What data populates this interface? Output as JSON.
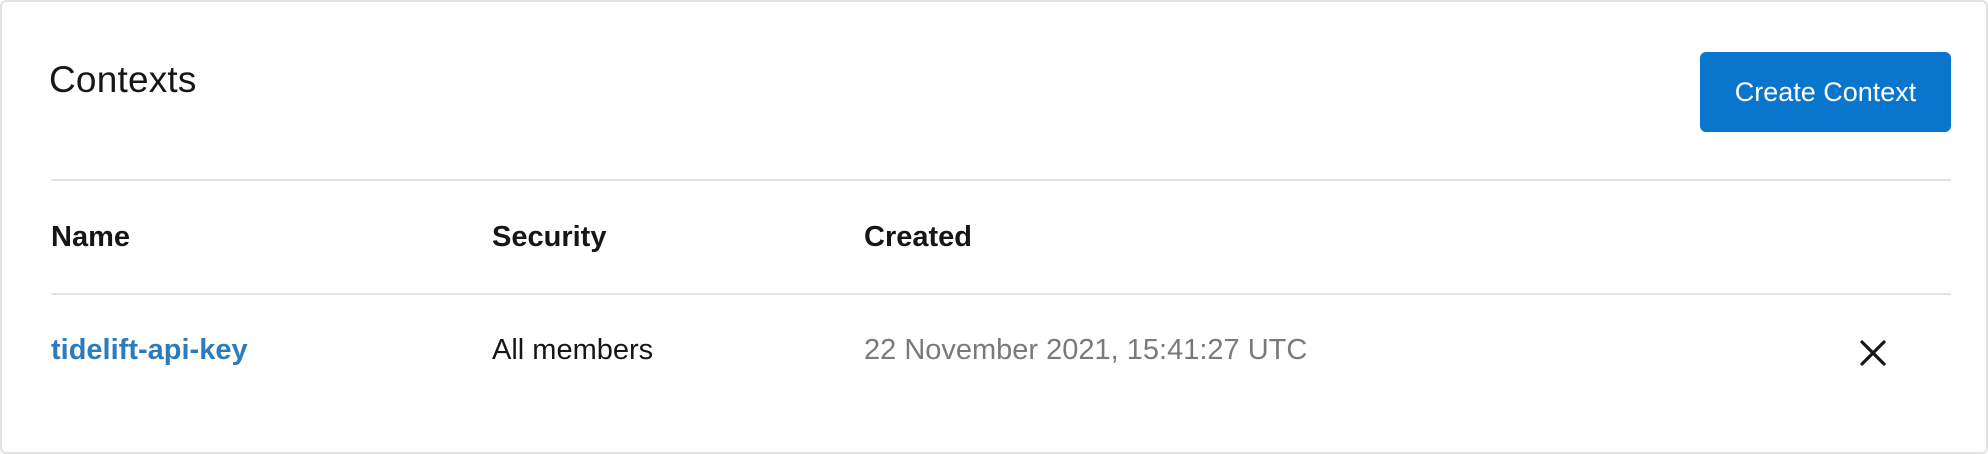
{
  "header": {
    "title": "Contexts",
    "create_button_label": "Create Context"
  },
  "table": {
    "columns": [
      "Name",
      "Security",
      "Created"
    ],
    "rows": [
      {
        "name": "tidelift-api-key",
        "security": "All members",
        "created": "22 November 2021, 15:41:27 UTC",
        "delete_icon": "close-icon"
      }
    ]
  },
  "colors": {
    "primary_button": "#0a75cc",
    "link": "#2b7bbf",
    "muted_text": "#7a7a7a",
    "divider": "#e2e2e2"
  }
}
